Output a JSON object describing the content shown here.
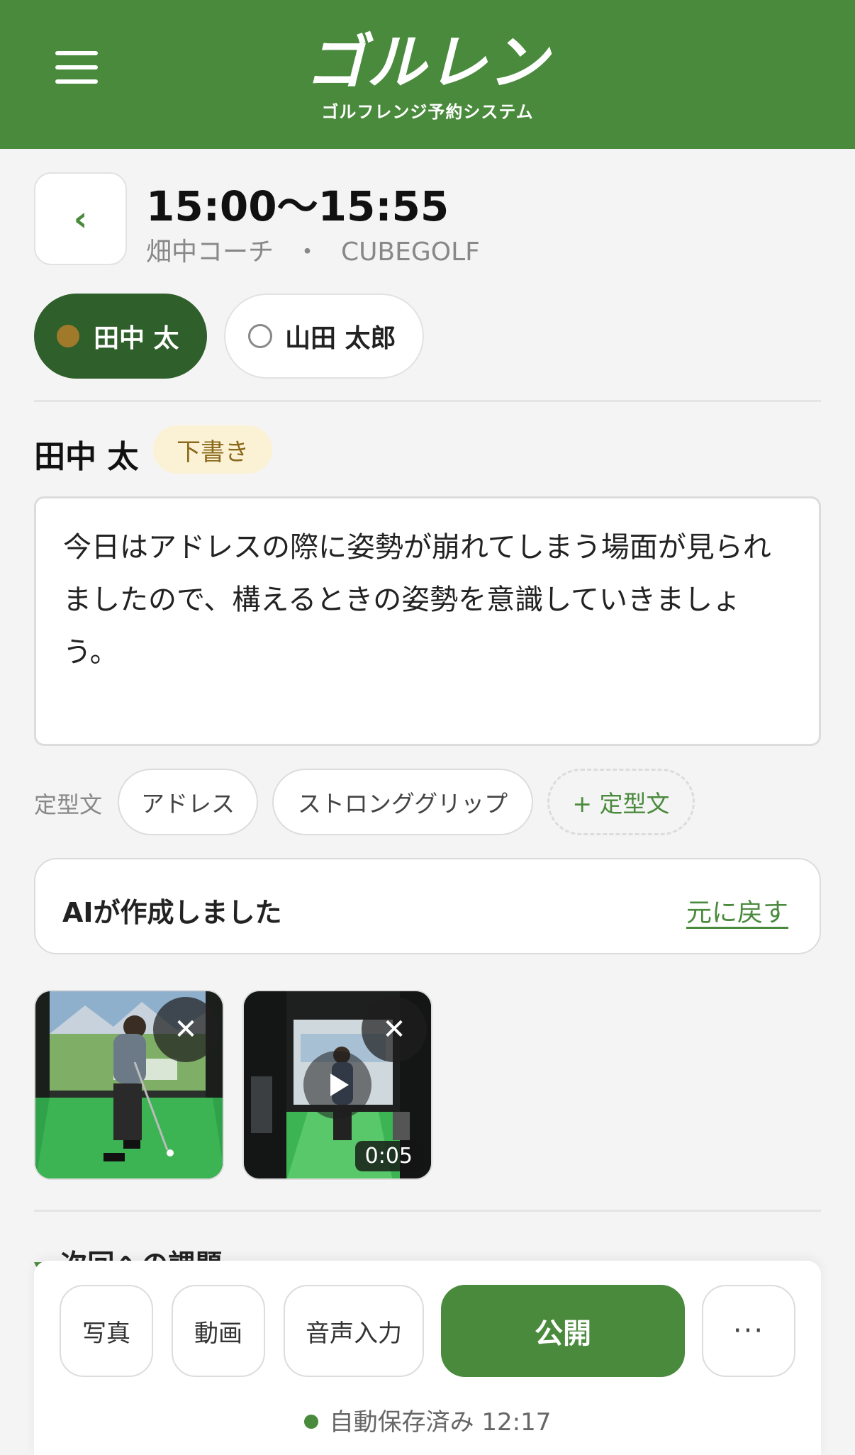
{
  "header": {
    "logo_main": "ゴルレン",
    "logo_sub": "ゴルフレンジ予約システム"
  },
  "session": {
    "time": "15:00〜15:55",
    "coach": "畑中コーチ",
    "separator": "・",
    "venue": "CUBEGOLF"
  },
  "students": [
    {
      "label": "田中 太",
      "selected": true
    },
    {
      "label": "山田 太郎",
      "selected": false
    }
  ],
  "editor": {
    "student_name": "田中 太",
    "status_badge": "下書き",
    "comment": "今日はアドレスの際に姿勢が崩れてしまう場面が見られましたので、構えるときの姿勢を意識していきましょう。"
  },
  "templates": {
    "label": "定型文",
    "chips": [
      "アドレス",
      "ストロンググリップ"
    ],
    "add_label": "+ 定型文"
  },
  "ai": {
    "message": "AIが作成しました",
    "revert_label": "元に戻す"
  },
  "media": [
    {
      "type": "photo"
    },
    {
      "type": "video",
      "duration": "0:05"
    }
  ],
  "next_task": {
    "title": "次回への課題"
  },
  "actions": {
    "photo": "写真",
    "video": "動画",
    "voice": "音声入力",
    "publish": "公開",
    "more": "···"
  },
  "autosave": {
    "text": "自動保存済み 12:17"
  },
  "colors": {
    "brand_green": "#4a8a3c",
    "dark_green": "#2f5f2a",
    "draft_bg": "#fbf2d6"
  }
}
